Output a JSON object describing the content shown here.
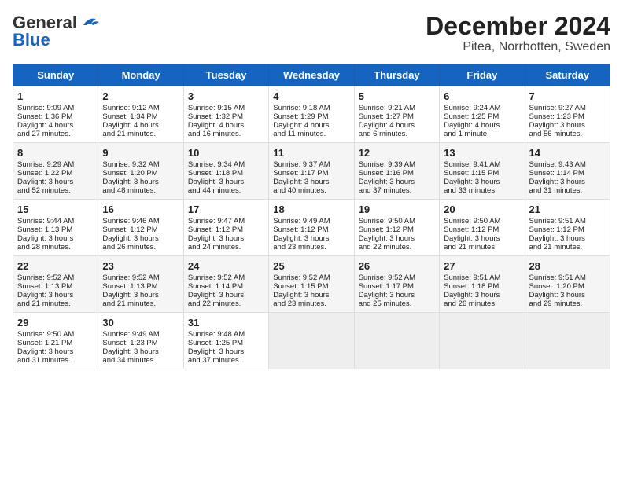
{
  "header": {
    "logo_general": "General",
    "logo_blue": "Blue",
    "title": "December 2024",
    "subtitle": "Pitea, Norrbotten, Sweden"
  },
  "days_of_week": [
    "Sunday",
    "Monday",
    "Tuesday",
    "Wednesday",
    "Thursday",
    "Friday",
    "Saturday"
  ],
  "weeks": [
    [
      {
        "day": "1",
        "info": "Sunrise: 9:09 AM\nSunset: 1:36 PM\nDaylight: 4 hours\nand 27 minutes."
      },
      {
        "day": "2",
        "info": "Sunrise: 9:12 AM\nSunset: 1:34 PM\nDaylight: 4 hours\nand 21 minutes."
      },
      {
        "day": "3",
        "info": "Sunrise: 9:15 AM\nSunset: 1:32 PM\nDaylight: 4 hours\nand 16 minutes."
      },
      {
        "day": "4",
        "info": "Sunrise: 9:18 AM\nSunset: 1:29 PM\nDaylight: 4 hours\nand 11 minutes."
      },
      {
        "day": "5",
        "info": "Sunrise: 9:21 AM\nSunset: 1:27 PM\nDaylight: 4 hours\nand 6 minutes."
      },
      {
        "day": "6",
        "info": "Sunrise: 9:24 AM\nSunset: 1:25 PM\nDaylight: 4 hours\nand 1 minute."
      },
      {
        "day": "7",
        "info": "Sunrise: 9:27 AM\nSunset: 1:23 PM\nDaylight: 3 hours\nand 56 minutes."
      }
    ],
    [
      {
        "day": "8",
        "info": "Sunrise: 9:29 AM\nSunset: 1:22 PM\nDaylight: 3 hours\nand 52 minutes."
      },
      {
        "day": "9",
        "info": "Sunrise: 9:32 AM\nSunset: 1:20 PM\nDaylight: 3 hours\nand 48 minutes."
      },
      {
        "day": "10",
        "info": "Sunrise: 9:34 AM\nSunset: 1:18 PM\nDaylight: 3 hours\nand 44 minutes."
      },
      {
        "day": "11",
        "info": "Sunrise: 9:37 AM\nSunset: 1:17 PM\nDaylight: 3 hours\nand 40 minutes."
      },
      {
        "day": "12",
        "info": "Sunrise: 9:39 AM\nSunset: 1:16 PM\nDaylight: 3 hours\nand 37 minutes."
      },
      {
        "day": "13",
        "info": "Sunrise: 9:41 AM\nSunset: 1:15 PM\nDaylight: 3 hours\nand 33 minutes."
      },
      {
        "day": "14",
        "info": "Sunrise: 9:43 AM\nSunset: 1:14 PM\nDaylight: 3 hours\nand 31 minutes."
      }
    ],
    [
      {
        "day": "15",
        "info": "Sunrise: 9:44 AM\nSunset: 1:13 PM\nDaylight: 3 hours\nand 28 minutes."
      },
      {
        "day": "16",
        "info": "Sunrise: 9:46 AM\nSunset: 1:12 PM\nDaylight: 3 hours\nand 26 minutes."
      },
      {
        "day": "17",
        "info": "Sunrise: 9:47 AM\nSunset: 1:12 PM\nDaylight: 3 hours\nand 24 minutes."
      },
      {
        "day": "18",
        "info": "Sunrise: 9:49 AM\nSunset: 1:12 PM\nDaylight: 3 hours\nand 23 minutes."
      },
      {
        "day": "19",
        "info": "Sunrise: 9:50 AM\nSunset: 1:12 PM\nDaylight: 3 hours\nand 22 minutes."
      },
      {
        "day": "20",
        "info": "Sunrise: 9:50 AM\nSunset: 1:12 PM\nDaylight: 3 hours\nand 21 minutes."
      },
      {
        "day": "21",
        "info": "Sunrise: 9:51 AM\nSunset: 1:12 PM\nDaylight: 3 hours\nand 21 minutes."
      }
    ],
    [
      {
        "day": "22",
        "info": "Sunrise: 9:52 AM\nSunset: 1:13 PM\nDaylight: 3 hours\nand 21 minutes."
      },
      {
        "day": "23",
        "info": "Sunrise: 9:52 AM\nSunset: 1:13 PM\nDaylight: 3 hours\nand 21 minutes."
      },
      {
        "day": "24",
        "info": "Sunrise: 9:52 AM\nSunset: 1:14 PM\nDaylight: 3 hours\nand 22 minutes."
      },
      {
        "day": "25",
        "info": "Sunrise: 9:52 AM\nSunset: 1:15 PM\nDaylight: 3 hours\nand 23 minutes."
      },
      {
        "day": "26",
        "info": "Sunrise: 9:52 AM\nSunset: 1:17 PM\nDaylight: 3 hours\nand 25 minutes."
      },
      {
        "day": "27",
        "info": "Sunrise: 9:51 AM\nSunset: 1:18 PM\nDaylight: 3 hours\nand 26 minutes."
      },
      {
        "day": "28",
        "info": "Sunrise: 9:51 AM\nSunset: 1:20 PM\nDaylight: 3 hours\nand 29 minutes."
      }
    ],
    [
      {
        "day": "29",
        "info": "Sunrise: 9:50 AM\nSunset: 1:21 PM\nDaylight: 3 hours\nand 31 minutes."
      },
      {
        "day": "30",
        "info": "Sunrise: 9:49 AM\nSunset: 1:23 PM\nDaylight: 3 hours\nand 34 minutes."
      },
      {
        "day": "31",
        "info": "Sunrise: 9:48 AM\nSunset: 1:25 PM\nDaylight: 3 hours\nand 37 minutes."
      },
      {
        "day": "",
        "info": ""
      },
      {
        "day": "",
        "info": ""
      },
      {
        "day": "",
        "info": ""
      },
      {
        "day": "",
        "info": ""
      }
    ]
  ]
}
